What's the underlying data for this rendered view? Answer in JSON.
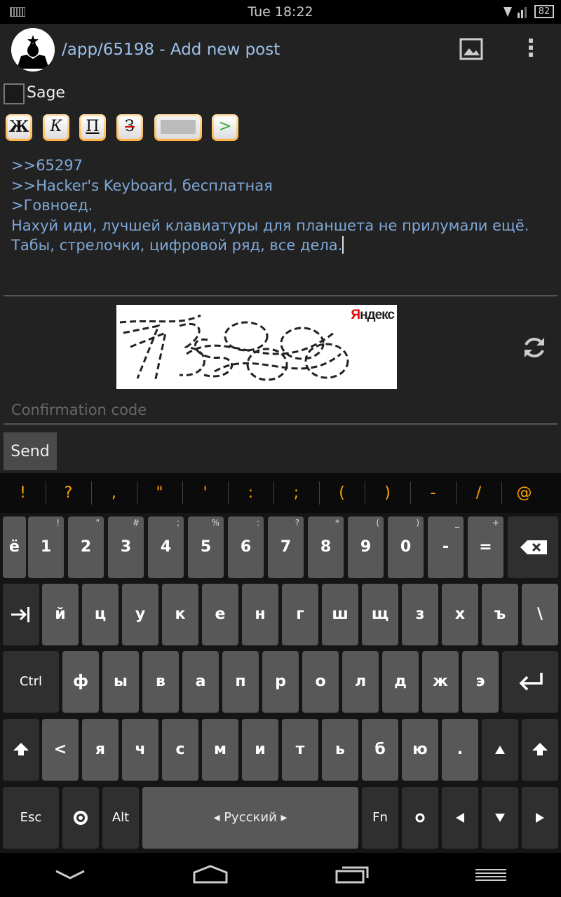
{
  "status": {
    "time": "Tue 18:22",
    "battery": "82"
  },
  "app": {
    "title": "/app/65198 - Add new post"
  },
  "sage": {
    "label": "Sage"
  },
  "format_buttons": [
    "Ж",
    "К",
    "П",
    "З",
    "",
    ">"
  ],
  "post": {
    "text": ">>65297\n>>Hacker's Keyboard, бесплатная\n>Говноед.\nНахуй иди, лучшей клавиатуры для планшета не прилумали ещё.\nТабы, стрелочки, цифровой ряд, все дела."
  },
  "captcha": {
    "brand": "ндекс",
    "brand_first": "Я",
    "code": "75368"
  },
  "confirm": {
    "placeholder": "Confirmation code"
  },
  "send": {
    "label": "Send"
  },
  "suggestions": [
    "!",
    "?",
    ",",
    "\"",
    "'",
    ":",
    ";",
    "(",
    ")",
    "-",
    "/",
    "@"
  ],
  "keyboard": {
    "row1": [
      [
        "ё",
        ""
      ],
      [
        "1",
        "!"
      ],
      [
        "2",
        "\""
      ],
      [
        "3",
        "#"
      ],
      [
        "4",
        ";"
      ],
      [
        "5",
        "%"
      ],
      [
        "6",
        ":"
      ],
      [
        "7",
        "?"
      ],
      [
        "8",
        "*"
      ],
      [
        "9",
        "("
      ],
      [
        "0",
        ")"
      ],
      [
        "-",
        "_"
      ],
      [
        "=",
        "+"
      ]
    ],
    "row2": [
      "й",
      "ц",
      "у",
      "к",
      "е",
      "н",
      "г",
      "ш",
      "щ",
      "з",
      "х",
      "ъ",
      "\\"
    ],
    "row3": [
      "ф",
      "ы",
      "в",
      "а",
      "п",
      "р",
      "о",
      "л",
      "д",
      "ж",
      "э"
    ],
    "row4": [
      "<",
      "я",
      "ч",
      "с",
      "м",
      "и",
      "т",
      "ь",
      "б",
      "ю",
      "."
    ],
    "ctrl": "Ctrl",
    "esc": "Esc",
    "alt": "Alt",
    "fn": "Fn",
    "space": "Русский"
  },
  "colors": {
    "accent": "#ffa500",
    "link": "#7fa8d8",
    "key": "#585858"
  }
}
